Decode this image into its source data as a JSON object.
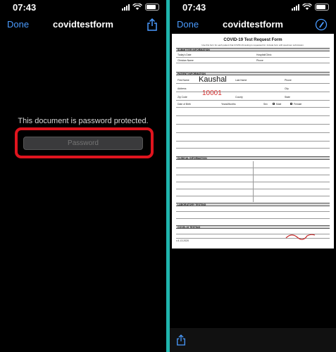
{
  "left": {
    "status": {
      "time": "07:43"
    },
    "nav": {
      "done": "Done",
      "title": "covidtestform",
      "right_icon": "share-icon"
    },
    "message": "This document is password protected.",
    "password": {
      "placeholder": "Password",
      "value": ""
    }
  },
  "right": {
    "status": {
      "time": "07:43"
    },
    "nav": {
      "done": "Done",
      "title": "covidtestform",
      "right_icon": "markup-icon"
    },
    "doc": {
      "title": "COVID-19 Test Request Form",
      "subtitle": "Use this form for each patient that COVID-19 testing is requested for. Include form with specimen submission.",
      "sections": [
        "SUBMITTER INFORMATION",
        "PATIENT INFORMATION",
        "CLINICAL INFORMATION",
        "LABORATORY TESTING",
        "COVID-19 TESTING"
      ],
      "submitter_fields": [
        "Today's Date",
        "Hospital/Clinic",
        "Clinician Name",
        "Phone"
      ],
      "patient_fields": [
        "First Name",
        "Last Name",
        "Phone",
        "Address",
        "City",
        "Zip Code",
        "County",
        "State",
        "Date of Birth",
        "Years/Months",
        "Sex",
        "Male",
        "Female"
      ],
      "handwritten_name": "Kaushal",
      "handwritten_zip": "10001",
      "version": "v.4.13.2020"
    },
    "bottom_icon": "share-icon"
  },
  "colors": {
    "accent": "#4a9bff",
    "highlight": "#e0141e",
    "frame": "#1fb5ad"
  }
}
